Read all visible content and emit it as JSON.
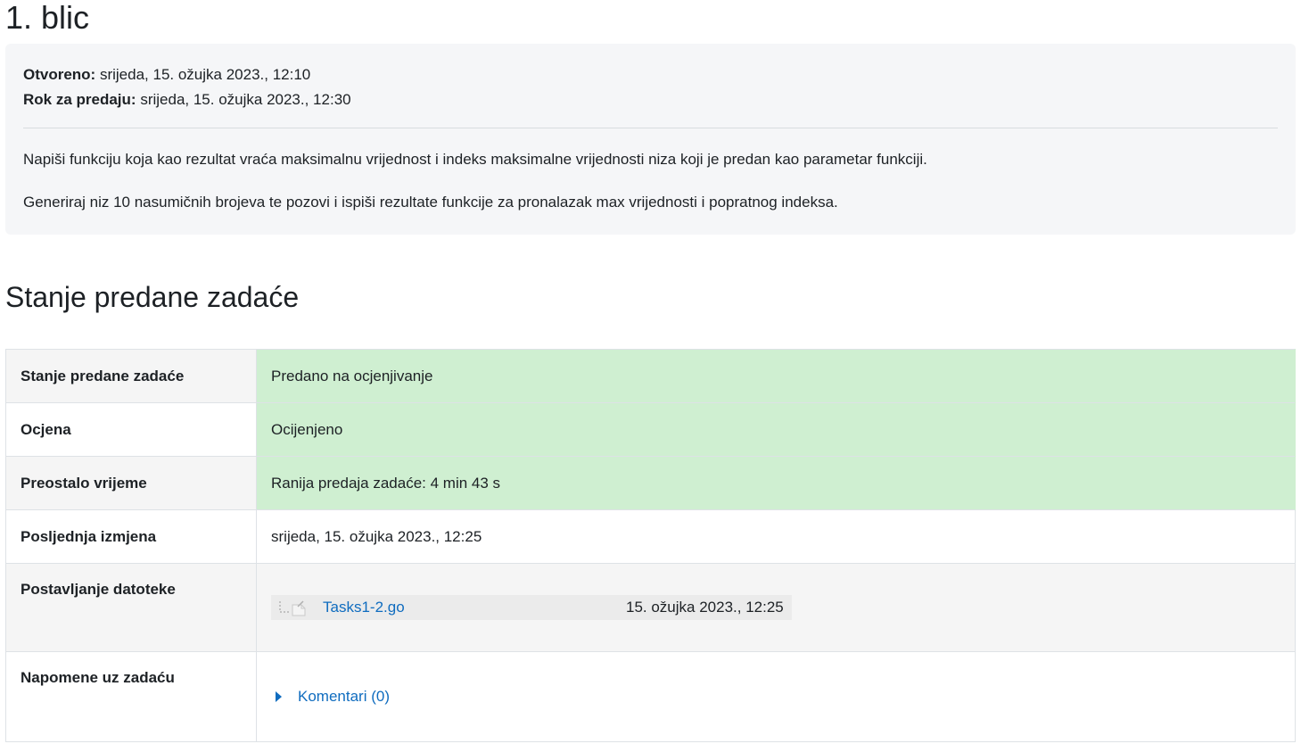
{
  "activity": {
    "title": "1. blic",
    "opened_label": "Otvoreno:",
    "opened_value": "srijeda, 15. ožujka 2023., 12:10",
    "due_label": "Rok za predaju:",
    "due_value": "srijeda, 15. ožujka 2023., 12:30",
    "description": [
      "Napiši funkciju koja kao rezultat vraća maksimalnu vrijednost i indeks maksimalne vrijednosti niza koji je predan kao parametar funkciji.",
      "Generiraj niz 10 nasumičnih brojeva te pozovi i ispiši rezultate funkcije za pronalazak max vrijednosti i popratnog indeksa."
    ]
  },
  "submission": {
    "section_title": "Stanje predane zadaće",
    "rows": {
      "status": {
        "label": "Stanje predane zadaće",
        "value": "Predano na ocjenjivanje",
        "highlight": "#cfefd1"
      },
      "grade": {
        "label": "Ocjena",
        "value": "Ocijenjeno",
        "highlight": "#cfefd1"
      },
      "time_remaining": {
        "label": "Preostalo vrijeme",
        "value": "Ranija predaja zadaće: 4 min 43 s",
        "highlight": "#cfefd1"
      },
      "last_modified": {
        "label": "Posljednja izmjena",
        "value": "srijeda, 15. ožujka 2023., 12:25"
      },
      "file_submissions": {
        "label": "Postavljanje datoteke",
        "file": {
          "name": "Tasks1-2.go",
          "date": "15. ožujka 2023., 12:25",
          "icon": "file-icon"
        }
      },
      "comments": {
        "label": "Napomene uz zadaću",
        "link": "Komentari (0)",
        "icon": "caret-right-icon"
      }
    }
  },
  "colors": {
    "link": "#0f6cbf",
    "success_bg": "#cfefd1",
    "info_bg": "#f5f6f8",
    "stripe_bg": "#f5f5f5"
  }
}
